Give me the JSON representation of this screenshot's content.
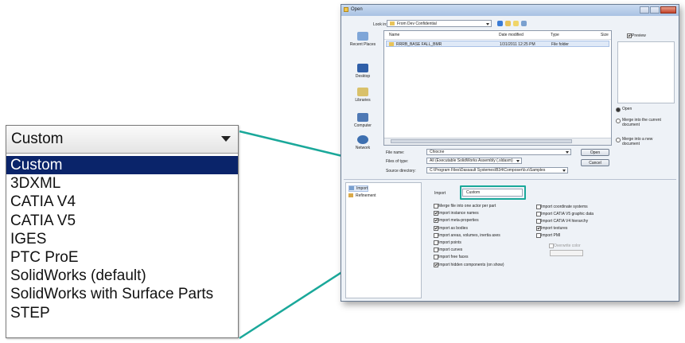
{
  "zoom_dropdown": {
    "selected_value": "Custom",
    "options": [
      "Custom",
      "3DXML",
      "CATIA V4",
      "CATIA V5",
      "IGES",
      "PTC ProE",
      "SolidWorks (default)",
      "SolidWorks with Surface Parts",
      "STEP"
    ],
    "highlighted_index": 0
  },
  "dialog": {
    "title": "Open",
    "look_in_label": "Look in:",
    "look_in_value": "From Dev Confidential",
    "places": [
      "Recent Places",
      "Desktop",
      "Libraries",
      "Computer",
      "Network"
    ],
    "columns": [
      "Name",
      "Date modified",
      "Type",
      "Size"
    ],
    "files": [
      {
        "name": "RRRB_BASE FALL_BMR",
        "date": "1/31/2011 12:25 PM",
        "type": "File folder",
        "size": ""
      }
    ],
    "preview_label": "Preview",
    "radio_options": [
      "Open",
      "Merge into the current document",
      "Merge into a new document"
    ],
    "file_name_label": "File name:",
    "file_name_value": "Chiocne",
    "files_of_type_label": "Files of type:",
    "files_of_type_value": "All (Executable SolidWorks Assembly (.sldasm)",
    "source_label": "Source directory:",
    "source_value": "C:\\Program Files\\Dassault Systemes\\B34\\Composer\\b.x\\Samples",
    "open_button": "Open",
    "cancel_button": "Cancel",
    "tree_items": [
      "Import",
      "Refinement"
    ],
    "import_label": "Import",
    "import_select_value": "Custom",
    "options_left": [
      {
        "label": "Merge file into one actor per part",
        "checked": false
      },
      {
        "label": "Import instance names",
        "checked": true
      },
      {
        "label": "Import meta-properties",
        "checked": true
      },
      {
        "label": "Import as bodies",
        "checked": true
      },
      {
        "label": "Import areas, volumes, inertia axes",
        "checked": false
      },
      {
        "label": "Import points",
        "checked": false
      },
      {
        "label": "Import curves",
        "checked": false
      },
      {
        "label": "Import free faces",
        "checked": false
      },
      {
        "label": "Import hidden components (on show)",
        "checked": true
      }
    ],
    "options_right": [
      {
        "label": "Import coordinate systems",
        "checked": false
      },
      {
        "label": "Import CATIA V5 graphic data",
        "checked": false
      },
      {
        "label": "Import CATIA V4 hierarchy",
        "checked": false
      },
      {
        "label": "Import textures",
        "checked": true
      },
      {
        "label": "Import PMI",
        "checked": false
      }
    ],
    "tolerance_label": "Overwrite color"
  },
  "colors": {
    "highlight_teal": "#1aa89a",
    "selection_navy": "#0a246a"
  }
}
